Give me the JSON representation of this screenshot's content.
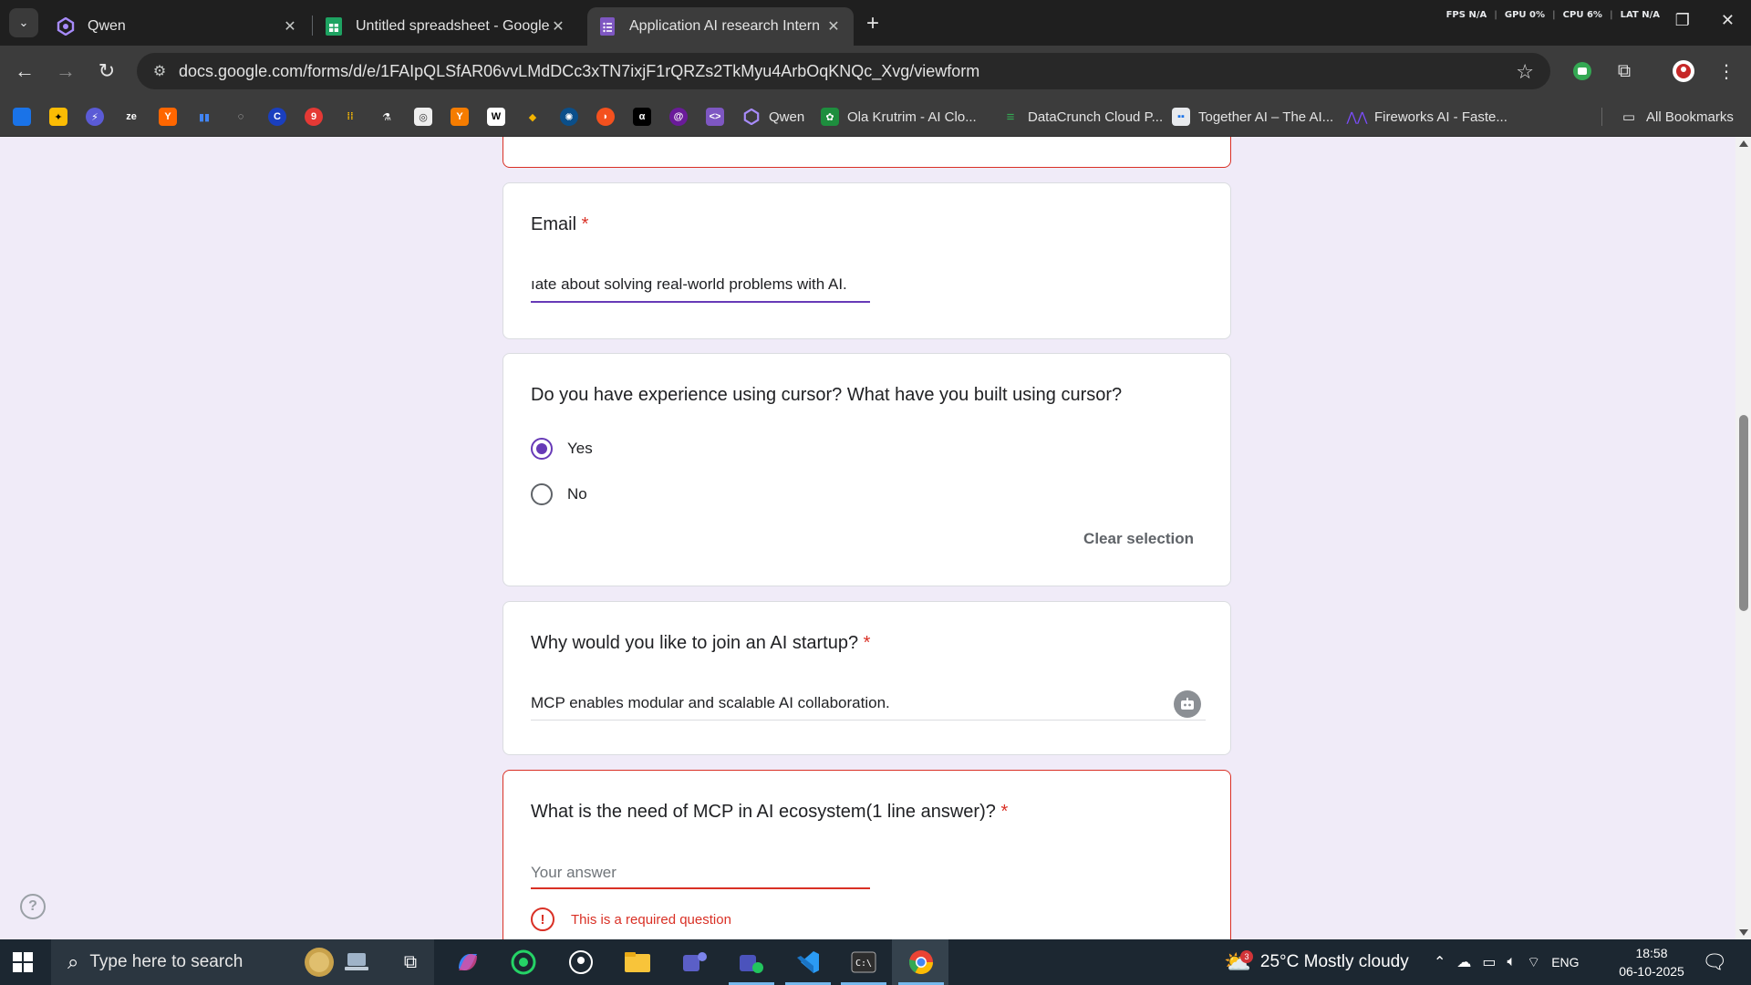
{
  "browser": {
    "tabs": [
      {
        "label": "Qwen",
        "active": false
      },
      {
        "label": "Untitled spreadsheet - Google Sheets",
        "active": false
      },
      {
        "label": "Application AI research Intern",
        "active": true
      }
    ],
    "new_tab_symbol": "+",
    "perf": {
      "fps_label": "FPS",
      "fps_value": "N/A",
      "gpu_label": "GPU",
      "gpu_value": "0%",
      "cpu_label": "CPU",
      "cpu_value": "6%",
      "lat_label": "LAT",
      "lat_value": "N/A"
    },
    "url": "docs.google.com/forms/d/e/1FAIpQLSfAR06vvLMdDCc3xTN7ixjF1rQRZs2TkMyu4ArbOqKNQc_Xvg/viewform",
    "bookmarks": [
      {
        "label": "Qwen",
        "icon": "qwen-icon"
      },
      {
        "label": "Ola Krutrim - AI Clo...",
        "icon": "krutrim-icon"
      },
      {
        "label": "DataCrunch Cloud P...",
        "icon": "datacrunch-icon"
      },
      {
        "label": "Together AI – The AI...",
        "icon": "together-icon"
      },
      {
        "label": "Fireworks AI - Faste...",
        "icon": "fireworks-icon"
      }
    ],
    "bookmark_icons": [
      "Y",
      "Y",
      "9",
      "C",
      "ze",
      "W"
    ],
    "all_bookmarks_label": "All Bookmarks"
  },
  "form": {
    "email": {
      "title": "Email",
      "required_mark": "*",
      "value": "ıate about solving real-world problems with AI."
    },
    "cursor_question": {
      "title": "Do you have experience using cursor? What have you built using cursor?",
      "options": [
        {
          "label": "Yes",
          "checked": true
        },
        {
          "label": "No",
          "checked": false
        }
      ],
      "clear_label": "Clear selection"
    },
    "startup_question": {
      "title": "Why would you like to join an AI startup?",
      "required_mark": "*",
      "value": "MCP enables modular and scalable AI collaboration."
    },
    "mcp_question": {
      "title": "What is the need of MCP in AI ecosystem(1 line answer)?",
      "required_mark": "*",
      "placeholder": "Your answer",
      "error_text": "This is a required question"
    },
    "help_symbol": "?"
  },
  "taskbar": {
    "search_placeholder": "Type here to search",
    "weather_badge": "3",
    "weather": "25°C  Mostly cloudy",
    "language": "ENG",
    "time": "18:58",
    "date": "06-10-2025"
  },
  "colors": {
    "accent": "#673ab7",
    "error": "#d93025",
    "page_bg": "#f0ebf8"
  }
}
